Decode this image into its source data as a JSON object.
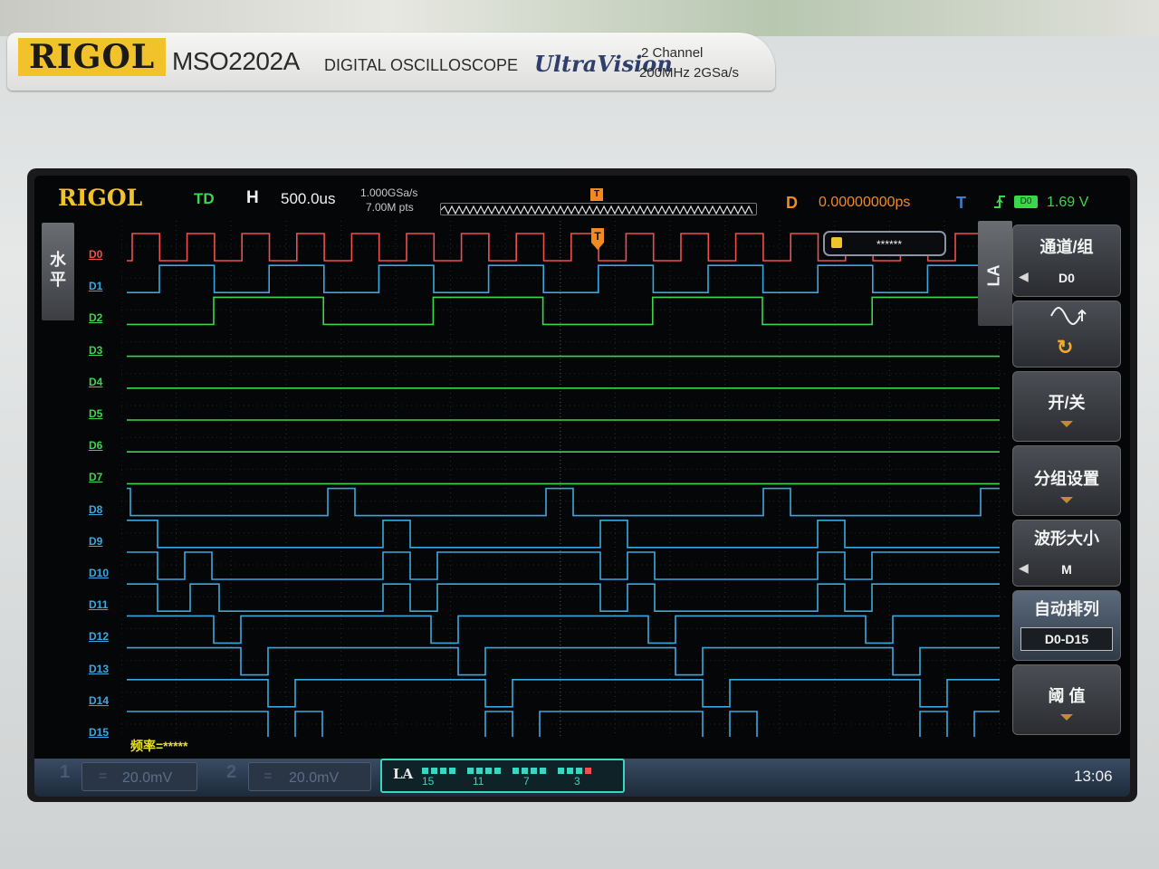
{
  "device": {
    "brand": "RIGOL",
    "model": "MSO2202A",
    "product_line": "DIGITAL OSCILLOSCOPE",
    "series": "UltraVision",
    "spec_channels": "2 Channel",
    "spec_perf": "200MHz  2GSa/s"
  },
  "top_bar": {
    "logo": "RIGOL",
    "run_status": "TD",
    "horizontal_label": "H",
    "timebase": "500.0us",
    "sample_rate": "1.000GSa/s",
    "memory_depth": "7.00M pts",
    "mem_trigger_marker": "T",
    "delay_label": "D",
    "delay_value": "0.00000000ps",
    "trigger_label": "T",
    "trigger_edge_icon": "rising-edge-icon",
    "trigger_source": "D0",
    "trigger_level": "1.69 V"
  },
  "horizontal_tab": {
    "label": "水平"
  },
  "trigger_marker": "T",
  "trigger_info_box": "******",
  "channels": [
    {
      "name": "D0",
      "color": "#ef4f4f"
    },
    {
      "name": "D1",
      "color": "#3aa8e0"
    },
    {
      "name": "D2",
      "color": "#37d84a"
    },
    {
      "name": "D3",
      "color": "#37d84a"
    },
    {
      "name": "D4",
      "color": "#37d84a"
    },
    {
      "name": "D5",
      "color": "#37d84a"
    },
    {
      "name": "D6",
      "color": "#37d84a"
    },
    {
      "name": "D7",
      "color": "#37d84a"
    },
    {
      "name": "D8",
      "color": "#3aa8e0"
    },
    {
      "name": "D9",
      "color": "#3aa8e0"
    },
    {
      "name": "D10",
      "color": "#3aa8e0"
    },
    {
      "name": "D11",
      "color": "#3aa8e0"
    },
    {
      "name": "D12",
      "color": "#3aa8e0"
    },
    {
      "name": "D13",
      "color": "#3aa8e0"
    },
    {
      "name": "D14",
      "color": "#3aa8e0"
    },
    {
      "name": "D15",
      "color": "#3aa8e0"
    }
  ],
  "side_menu": {
    "tab_label": "LA",
    "channel_group_label": "通道/组",
    "channel_group_value": "D0",
    "edge_icon": "waveform-edge-icon",
    "rotate_icon": "rotate-icon",
    "on_off_label": "开/关",
    "group_settings_label": "分组设置",
    "waveform_size_label": "波形大小",
    "waveform_size_value": "M",
    "auto_arrange_label": "自动排列",
    "auto_arrange_value": "D0-D15",
    "threshold_label": "阈 值"
  },
  "frequency_readout": "频率=*****",
  "status_bar": {
    "ch1_number": "1",
    "ch1_coupling": "=",
    "ch1_scale": "20.0mV",
    "ch2_number": "2",
    "ch2_coupling": "=",
    "ch2_scale": "20.0mV",
    "la_label": "LA",
    "la_group_numbers": [
      "15",
      "11",
      "7",
      "3"
    ],
    "time": "13:06"
  }
}
